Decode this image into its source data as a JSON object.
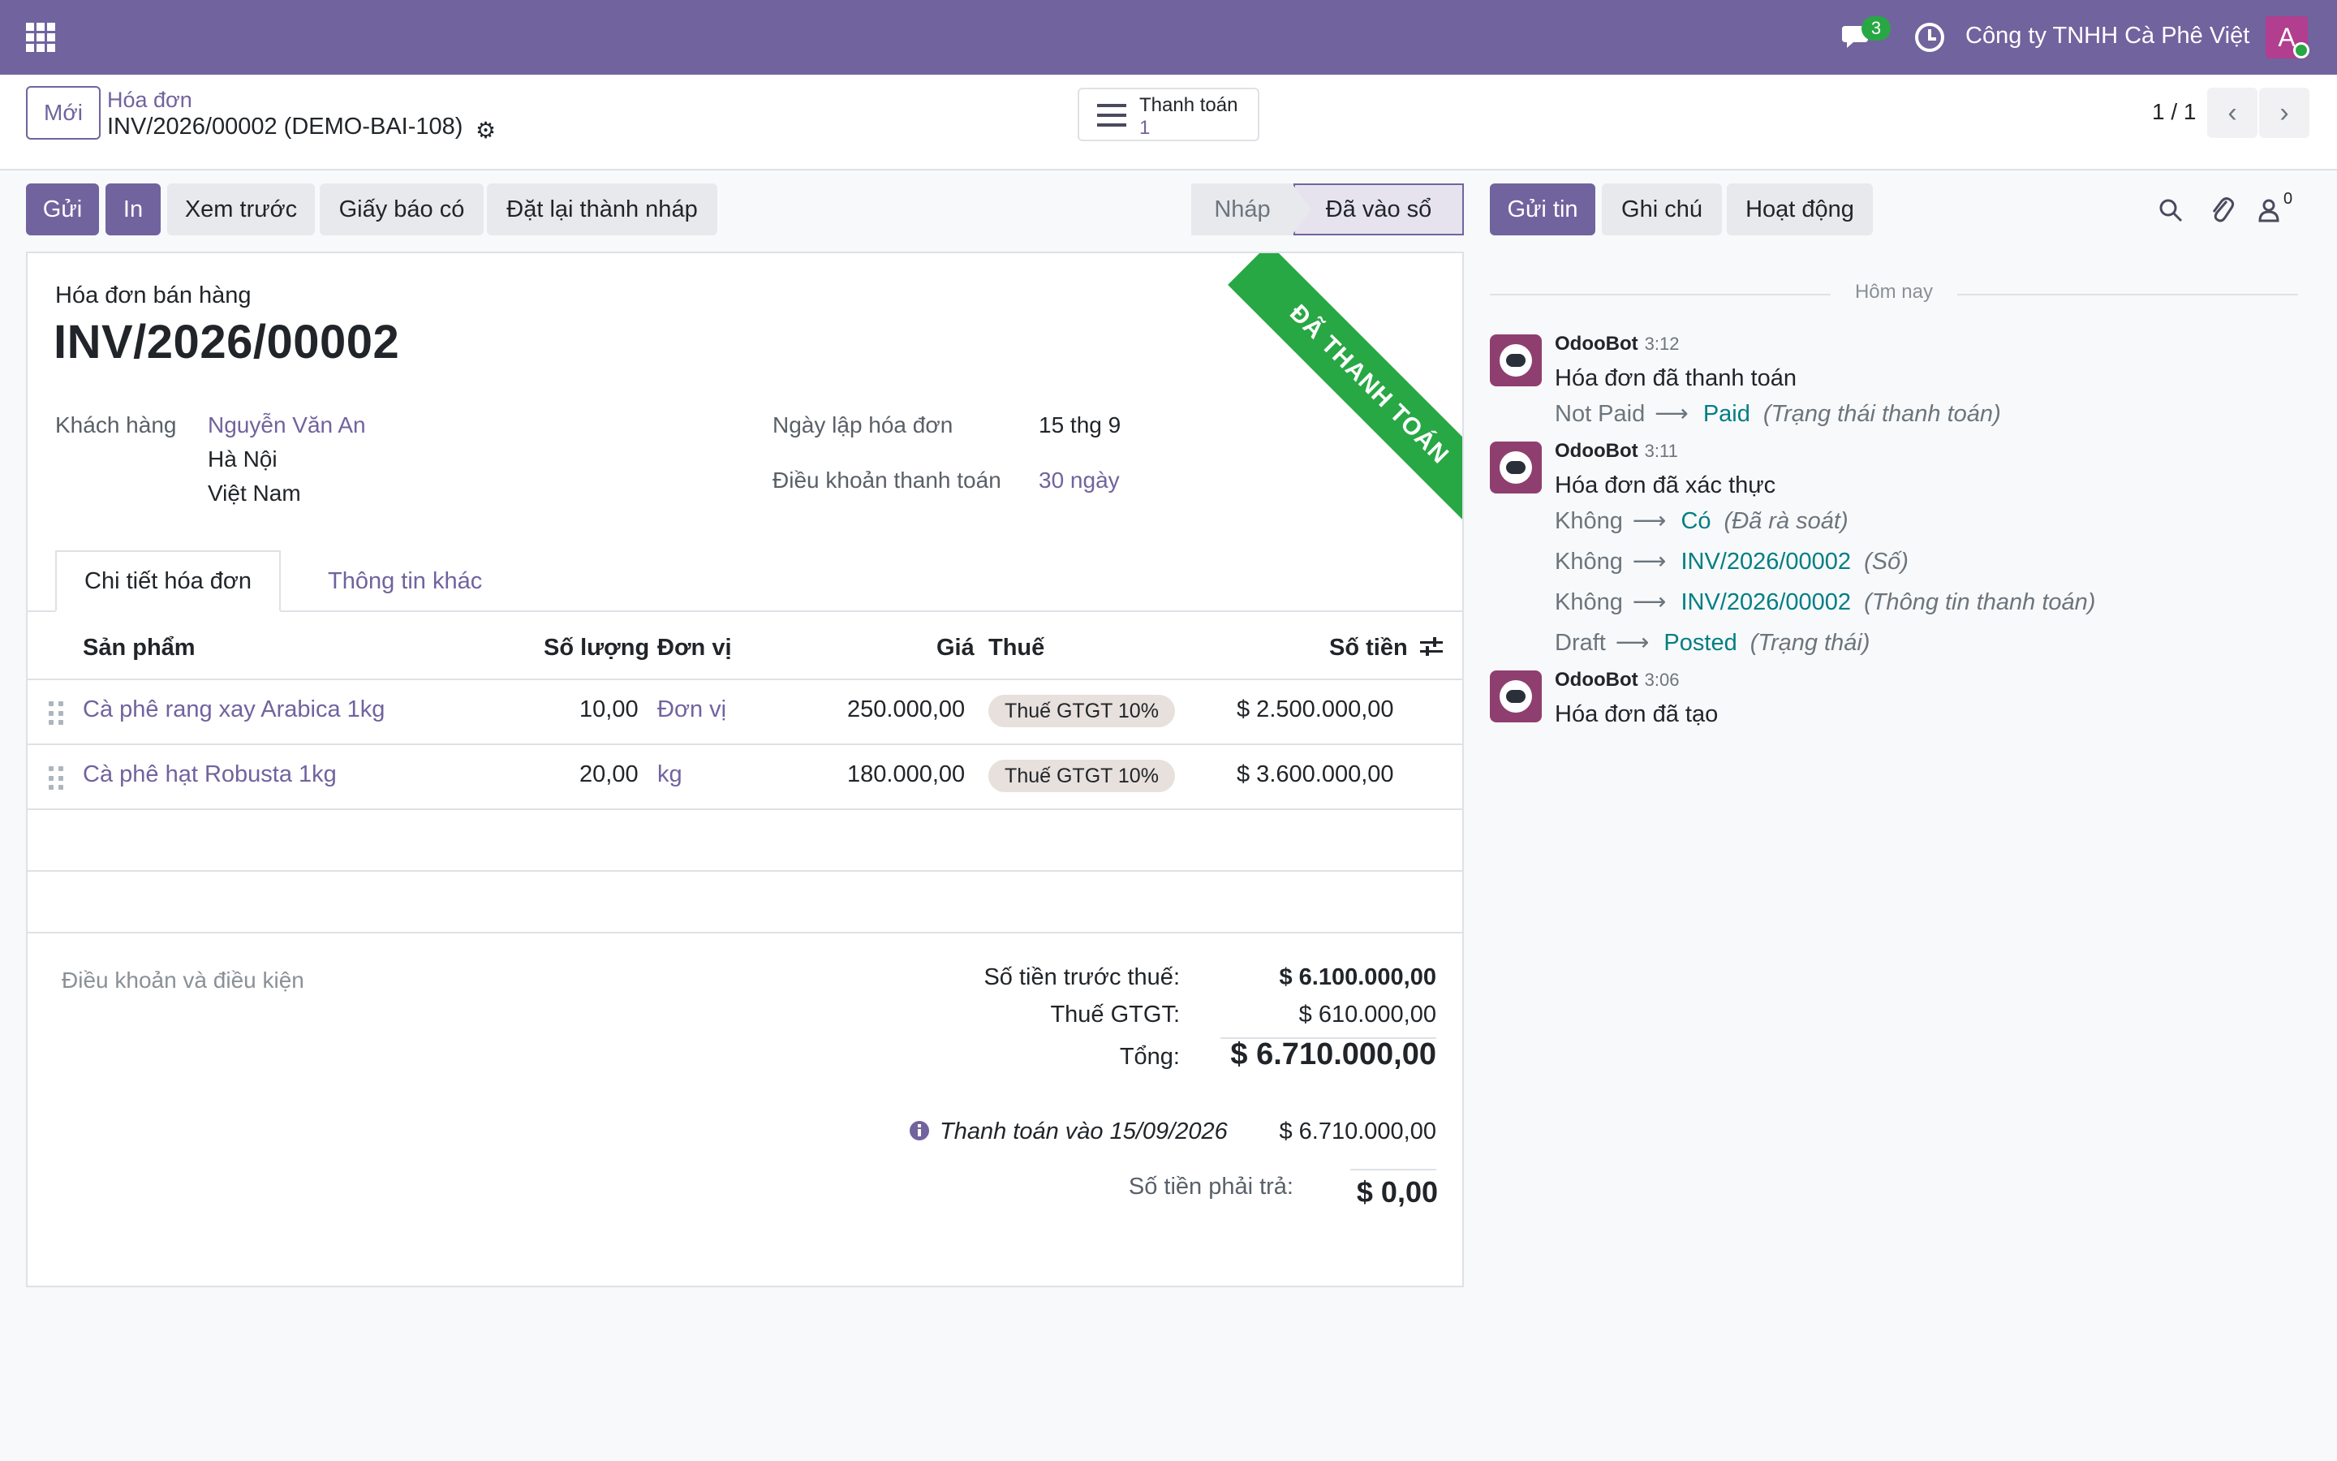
{
  "topbar": {
    "messages_badge": "3",
    "company": "Công ty TNHH Cà Phê Việt",
    "avatar_letter": "A"
  },
  "control": {
    "new_button": "Mới",
    "breadcrumb_parent": "Hóa đơn",
    "breadcrumb_current": "INV/2026/00002 (DEMO-BAI-108)",
    "payment_label": "Thanh toán",
    "payment_count": "1",
    "pager": "1 / 1"
  },
  "actions": {
    "send": "Gửi",
    "print": "In",
    "preview": "Xem trước",
    "credit_note": "Giấy báo có",
    "reset_draft": "Đặt lại thành nháp"
  },
  "status": {
    "draft": "Nháp",
    "posted": "Đã vào sổ"
  },
  "invoice": {
    "ribbon": "ĐÃ THANH TOÁN",
    "type": "Hóa đơn bán hàng",
    "number": "INV/2026/00002",
    "customer_label": "Khách hàng",
    "customer_name": "Nguyễn Văn An",
    "customer_city": "Hà Nội",
    "customer_country": "Việt Nam",
    "date_label": "Ngày lập hóa đơn",
    "date_value": "15 thg 9",
    "terms_label": "Điều khoản thanh toán",
    "terms_value": "30 ngày"
  },
  "tabs": [
    "Chi tiết hóa đơn",
    "Thông tin khác"
  ],
  "table": {
    "headers": [
      "Sản phẩm",
      "Số lượng",
      "Đơn vị",
      "Giá",
      "Thuế",
      "Số tiền"
    ],
    "rows": [
      {
        "product": "Cà phê rang xay Arabica 1kg",
        "qty": "10,00",
        "unit": "Đơn vị",
        "price": "250.000,00",
        "tax": "Thuế GTGT 10%",
        "amount": "$ 2.500.000,00"
      },
      {
        "product": "Cà phê hạt Robusta 1kg",
        "qty": "20,00",
        "unit": "kg",
        "price": "180.000,00",
        "tax": "Thuế GTGT 10%",
        "amount": "$ 3.600.000,00"
      }
    ]
  },
  "totals": {
    "terms_placeholder": "Điều khoản và điều kiện",
    "untaxed_label": "Số tiền trước thuế:",
    "untaxed_value": "$ 6.100.000,00",
    "vat_label": "Thuế GTGT:",
    "vat_value": "$ 610.000,00",
    "total_label": "Tổng:",
    "total_value": "$ 6.710.000,00",
    "paid_label": "Thanh toán vào 15/09/2026",
    "paid_value": "$ 6.710.000,00",
    "due_label": "Số tiền phải trả:",
    "due_value": "$ 0,00"
  },
  "chatter": {
    "send_message": "Gửi tin",
    "log_note": "Ghi chú",
    "activity": "Hoạt động",
    "followers_count": "0",
    "today": "Hôm nay",
    "messages": [
      {
        "author": "OdooBot",
        "time": "3:12",
        "body": "Hóa đơn đã thanh toán",
        "tracking": [
          {
            "old": "Not Paid",
            "new": "Paid",
            "field": "(Trạng thái thanh toán)"
          }
        ]
      },
      {
        "author": "OdooBot",
        "time": "3:11",
        "body": "Hóa đơn đã xác thực",
        "tracking": [
          {
            "old": "Không",
            "new": "Có",
            "field": "(Đã rà soát)"
          },
          {
            "old": "Không",
            "new": "INV/2026/00002",
            "field": "(Số)"
          },
          {
            "old": "Không",
            "new": "INV/2026/00002",
            "field": "(Thông tin thanh toán)"
          },
          {
            "old": "Draft",
            "new": "Posted",
            "field": "(Trạng thái)"
          }
        ]
      },
      {
        "author": "OdooBot",
        "time": "3:06",
        "body": "Hóa đơn đã tạo",
        "tracking": []
      }
    ]
  },
  "colors": {
    "brand": "#71639e",
    "paid_ribbon": "#28a745",
    "tracking_value": "#017e84"
  }
}
